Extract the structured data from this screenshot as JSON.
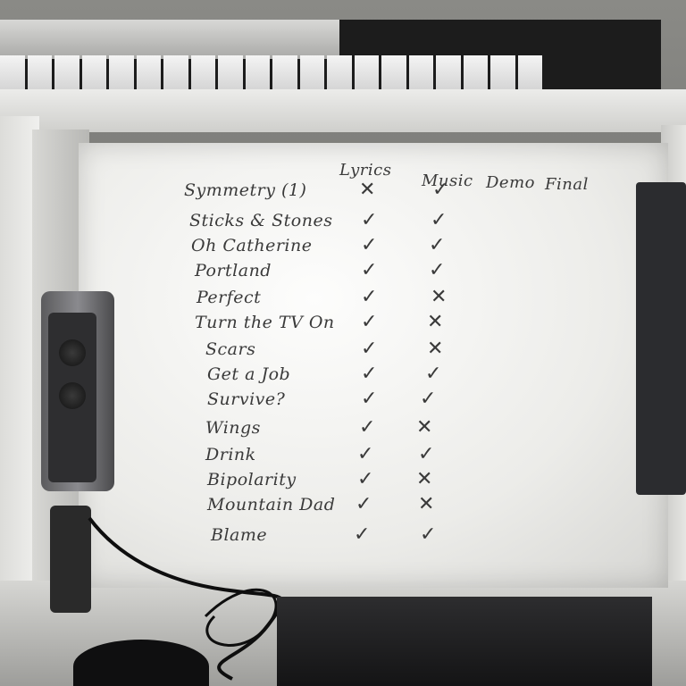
{
  "board": {
    "headers": [
      "Lyrics",
      "Music",
      "Demo",
      "Final"
    ],
    "songs": [
      {
        "title": "Symmetry (1)",
        "lyrics": "✕",
        "music": "✓"
      },
      {
        "title": "Sticks & Stones",
        "lyrics": "✓",
        "music": "✓"
      },
      {
        "title": "Oh Catherine",
        "lyrics": "✓",
        "music": "✓"
      },
      {
        "title": "Portland",
        "lyrics": "✓",
        "music": "✓"
      },
      {
        "title": "Perfect",
        "lyrics": "✓",
        "music": "✕"
      },
      {
        "title": "Turn the TV On",
        "lyrics": "✓",
        "music": "✕"
      },
      {
        "title": "Scars",
        "lyrics": "✓",
        "music": "✕"
      },
      {
        "title": "Get a Job",
        "lyrics": "✓",
        "music": "✓"
      },
      {
        "title": "Survive?",
        "lyrics": "✓",
        "music": "✓"
      },
      {
        "title": "Wings",
        "lyrics": "✓",
        "music": "✕"
      },
      {
        "title": "Drink",
        "lyrics": "✓",
        "music": "✓"
      },
      {
        "title": "Bipolarity",
        "lyrics": "✓",
        "music": "✕"
      },
      {
        "title": "Mountain Dad",
        "lyrics": "✓",
        "music": "✕"
      },
      {
        "title": "Blame",
        "lyrics": "✓",
        "music": "✓"
      }
    ]
  },
  "colors": {
    "marker": "#3a3a3a",
    "board": "#f4f4f2"
  }
}
